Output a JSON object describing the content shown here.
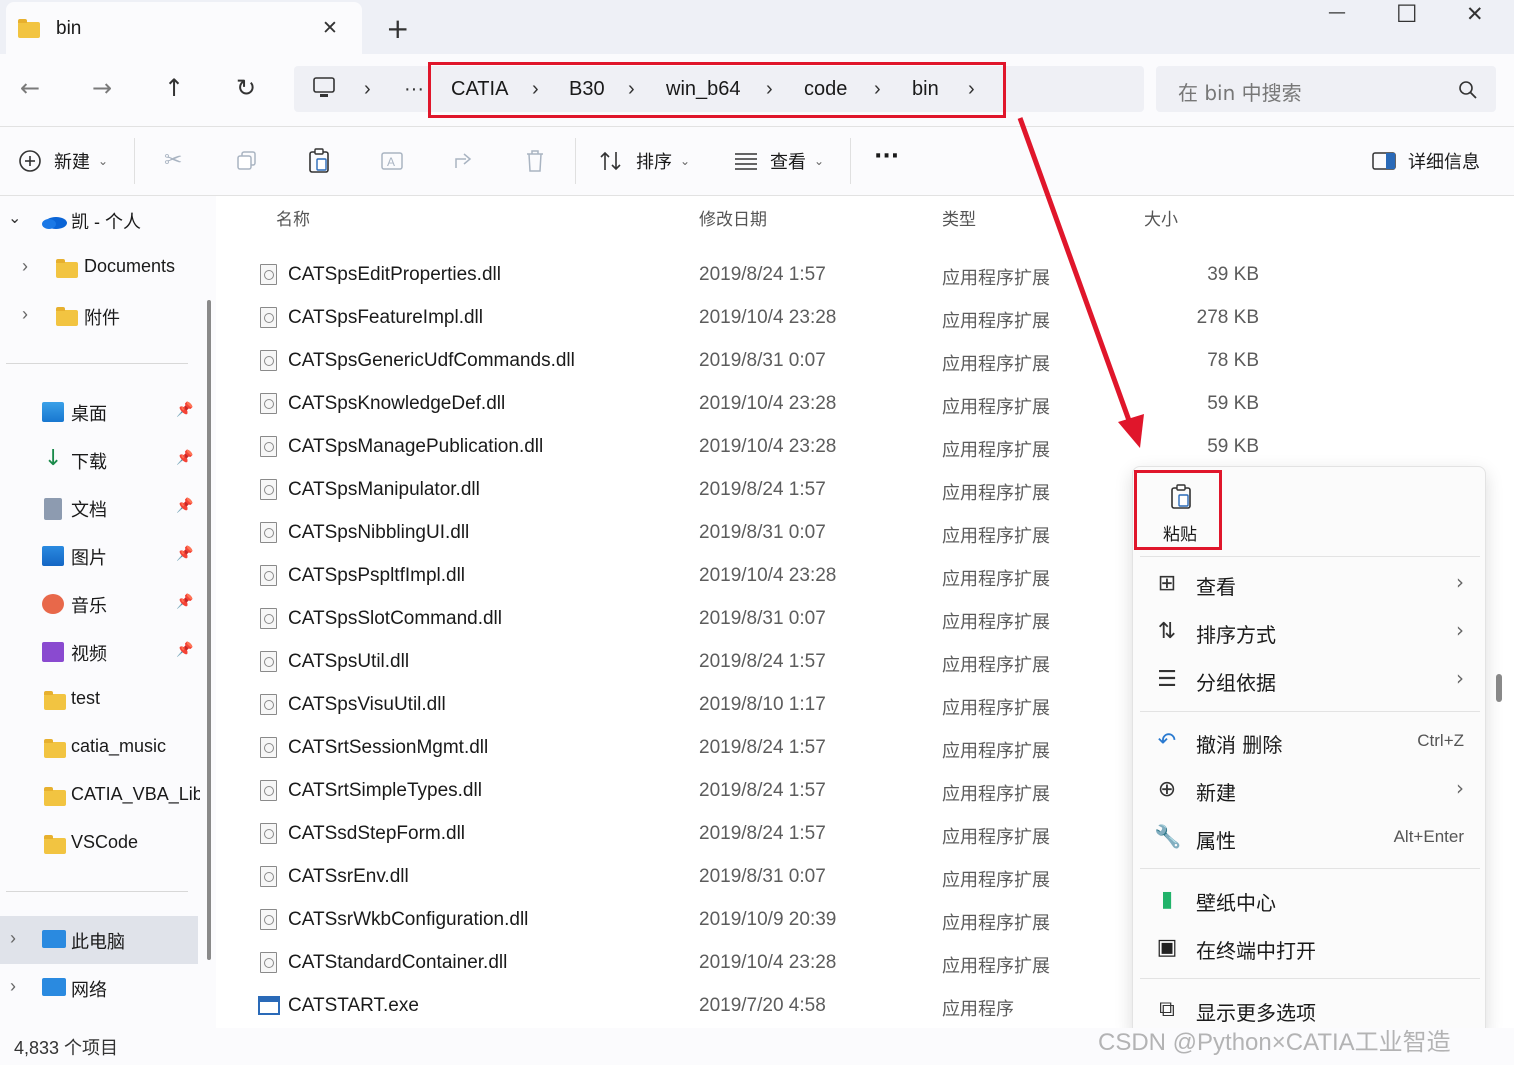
{
  "window": {
    "tab_title": "bin",
    "tab_close": "✕",
    "new_tab": "+",
    "minimize": "—",
    "maximize": "☐",
    "close": "✕"
  },
  "nav": {
    "back": "←",
    "forward": "→",
    "up": "↑",
    "refresh": "↻",
    "overflow": "···",
    "breadcrumbs": [
      "CATIA",
      "B30",
      "win_b64",
      "code",
      "bin"
    ],
    "search_placeholder": "在 bin 中搜索"
  },
  "toolbar": {
    "new_label": "新建",
    "sort_label": "排序",
    "view_label": "查看",
    "more_label": "···",
    "details_label": "详细信息"
  },
  "sidebar": {
    "onedrive": "凯 - 个人",
    "onedrive_children": [
      "Documents",
      "附件"
    ],
    "quick_access": [
      {
        "label": "桌面",
        "icon": "desktop-icon"
      },
      {
        "label": "下载",
        "icon": "download-icon"
      },
      {
        "label": "文档",
        "icon": "document-icon"
      },
      {
        "label": "图片",
        "icon": "pictures-icon"
      },
      {
        "label": "音乐",
        "icon": "music-icon"
      },
      {
        "label": "视频",
        "icon": "video-icon"
      }
    ],
    "folders": [
      "test",
      "catia_music",
      "CATIA_VBA_Lib",
      "VSCode"
    ],
    "this_pc": "此电脑",
    "network": "网络"
  },
  "columns": {
    "name": "名称",
    "date": "修改日期",
    "type": "类型",
    "size": "大小"
  },
  "files": [
    {
      "name": "CATSpsEditProperties.dll",
      "date": "2019/8/24 1:57",
      "type": "应用程序扩展",
      "size": "39 KB",
      "kind": "dll"
    },
    {
      "name": "CATSpsFeatureImpl.dll",
      "date": "2019/10/4 23:28",
      "type": "应用程序扩展",
      "size": "278 KB",
      "kind": "dll"
    },
    {
      "name": "CATSpsGenericUdfCommands.dll",
      "date": "2019/8/31 0:07",
      "type": "应用程序扩展",
      "size": "78 KB",
      "kind": "dll"
    },
    {
      "name": "CATSpsKnowledgeDef.dll",
      "date": "2019/10/4 23:28",
      "type": "应用程序扩展",
      "size": "59 KB",
      "kind": "dll"
    },
    {
      "name": "CATSpsManagePublication.dll",
      "date": "2019/10/4 23:28",
      "type": "应用程序扩展",
      "size": "59 KB",
      "kind": "dll"
    },
    {
      "name": "CATSpsManipulator.dll",
      "date": "2019/8/24 1:57",
      "type": "应用程序扩展",
      "size": "",
      "kind": "dll"
    },
    {
      "name": "CATSpsNibblingUI.dll",
      "date": "2019/8/31 0:07",
      "type": "应用程序扩展",
      "size": "",
      "kind": "dll"
    },
    {
      "name": "CATSpsPspltfImpl.dll",
      "date": "2019/10/4 23:28",
      "type": "应用程序扩展",
      "size": "",
      "kind": "dll"
    },
    {
      "name": "CATSpsSlotCommand.dll",
      "date": "2019/8/31 0:07",
      "type": "应用程序扩展",
      "size": "",
      "kind": "dll"
    },
    {
      "name": "CATSpsUtil.dll",
      "date": "2019/8/24 1:57",
      "type": "应用程序扩展",
      "size": "",
      "kind": "dll"
    },
    {
      "name": "CATSpsVisuUtil.dll",
      "date": "2019/8/10 1:17",
      "type": "应用程序扩展",
      "size": "",
      "kind": "dll"
    },
    {
      "name": "CATSrtSessionMgmt.dll",
      "date": "2019/8/24 1:57",
      "type": "应用程序扩展",
      "size": "",
      "kind": "dll"
    },
    {
      "name": "CATSrtSimpleTypes.dll",
      "date": "2019/8/24 1:57",
      "type": "应用程序扩展",
      "size": "",
      "kind": "dll"
    },
    {
      "name": "CATSsdStepForm.dll",
      "date": "2019/8/24 1:57",
      "type": "应用程序扩展",
      "size": "",
      "kind": "dll"
    },
    {
      "name": "CATSsrEnv.dll",
      "date": "2019/8/31 0:07",
      "type": "应用程序扩展",
      "size": "",
      "kind": "dll"
    },
    {
      "name": "CATSsrWkbConfiguration.dll",
      "date": "2019/10/9 20:39",
      "type": "应用程序扩展",
      "size": "",
      "kind": "dll"
    },
    {
      "name": "CATStandardContainer.dll",
      "date": "2019/10/4 23:28",
      "type": "应用程序扩展",
      "size": "",
      "kind": "dll"
    },
    {
      "name": "CATSTART.exe",
      "date": "2019/7/20 4:58",
      "type": "应用程序",
      "size": "",
      "kind": "exe"
    }
  ],
  "context_menu": {
    "paste": "粘贴",
    "items": [
      {
        "label": "查看",
        "icon": "grid-icon",
        "shortcut": "",
        "submenu": true
      },
      {
        "label": "排序方式",
        "icon": "sort-icon",
        "shortcut": "",
        "submenu": true
      },
      {
        "label": "分组依据",
        "icon": "list-icon",
        "shortcut": "",
        "submenu": true
      },
      {
        "label": "撤消 删除",
        "icon": "undo-icon",
        "shortcut": "Ctrl+Z",
        "submenu": false
      },
      {
        "label": "新建",
        "icon": "plus-circle-icon",
        "shortcut": "",
        "submenu": true
      },
      {
        "label": "属性",
        "icon": "wrench-icon",
        "shortcut": "Alt+Enter",
        "submenu": false
      },
      {
        "label": "壁纸中心",
        "icon": "wallpaper-icon",
        "shortcut": "",
        "submenu": false
      },
      {
        "label": "在终端中打开",
        "icon": "terminal-icon",
        "shortcut": "",
        "submenu": false
      },
      {
        "label": "显示更多选项",
        "icon": "more-options-icon",
        "shortcut": "",
        "submenu": false
      }
    ]
  },
  "status": {
    "item_count": "4,833 个项目"
  },
  "watermark": "CSDN @Python×CATIA工业智造",
  "colors": {
    "highlight_red": "#e0162b",
    "folder_yellow": "#f2c441",
    "accent_blue": "#0067c0"
  }
}
